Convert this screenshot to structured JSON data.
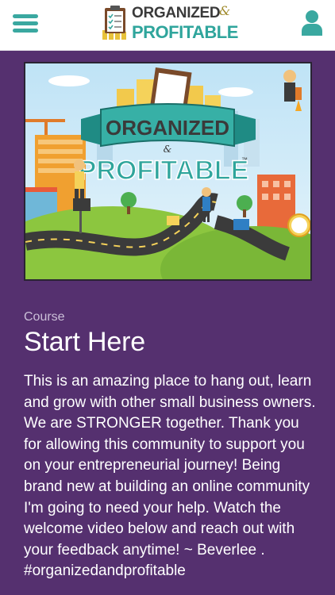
{
  "header": {
    "logo": {
      "line1": "ORGANIZED",
      "ampersand": "&",
      "line2": "PROFITABLE"
    },
    "menu_icon": "hamburger-menu-icon",
    "account_icon": "user-account-icon"
  },
  "banner": {
    "ribbon_text": "ORGANIZED",
    "ampersand": "&",
    "main_text": "PROFITABLE",
    "trademark": "™"
  },
  "course": {
    "label": "Course",
    "title": "Start Here",
    "description": "This is an amazing place to hang out, learn and grow with other small business owners. We are STRONGER together. Thank you for allowing this community to support you on your entrepreneurial journey!   Being brand new at building an online community I'm going to need your help.  Watch the welcome video below and reach out with your feedback anytime! ~ Beverlee .\n#organizedandprofitable"
  },
  "colors": {
    "background": "#55306f",
    "accent": "#3aa8a0",
    "header_bg": "#ffffff"
  }
}
